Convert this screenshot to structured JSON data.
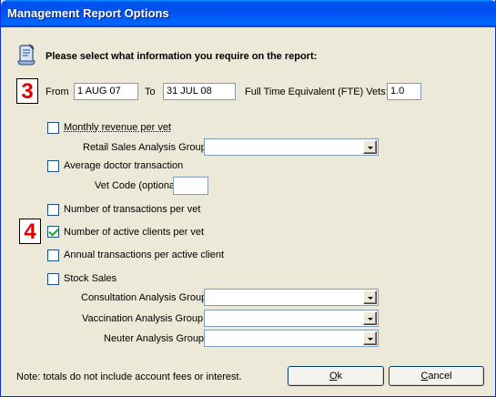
{
  "window": {
    "title": "Management Report Options"
  },
  "heading": "Please select what information you require on the report:",
  "markers": {
    "step3": "3",
    "step4": "4"
  },
  "dates": {
    "from_label": "From",
    "from_value": "1 AUG 07",
    "to_label": "To",
    "to_value": "31 JUL 08"
  },
  "fte": {
    "label": "Full Time Equivalent (FTE) Vets:",
    "value": "1.0"
  },
  "options": {
    "monthly_revenue": {
      "label": "Monthly revenue per vet",
      "checked": false
    },
    "retail_group": {
      "label": "Retail Sales Analysis Group",
      "value": ""
    },
    "avg_doctor": {
      "label": "Average doctor transaction",
      "checked": false
    },
    "vet_code": {
      "label": "Vet Code (optional) *",
      "value": ""
    },
    "num_transactions": {
      "label": "Number of transactions per vet",
      "checked": false
    },
    "active_clients": {
      "label": "Number of active clients per vet",
      "checked": true
    },
    "annual_transactions": {
      "label": "Annual transactions per active client",
      "checked": false
    },
    "stock_sales": {
      "label": "Stock Sales",
      "checked": false
    },
    "consultation_group": {
      "label": "Consultation Analysis Group",
      "value": ""
    },
    "vaccination_group": {
      "label": "Vaccination Analysis Group",
      "value": ""
    },
    "neuter_group": {
      "label": "Neuter Analysis Group",
      "value": ""
    }
  },
  "note": "Note: totals do not include account fees or interest.",
  "buttons": {
    "ok": "Ok",
    "cancel": "Cancel"
  },
  "colors": {
    "title_bar": "#0053ee",
    "marker_red": "#e00000",
    "window_bg": "#ece9d8"
  },
  "icons": {
    "header": "report-icon"
  }
}
